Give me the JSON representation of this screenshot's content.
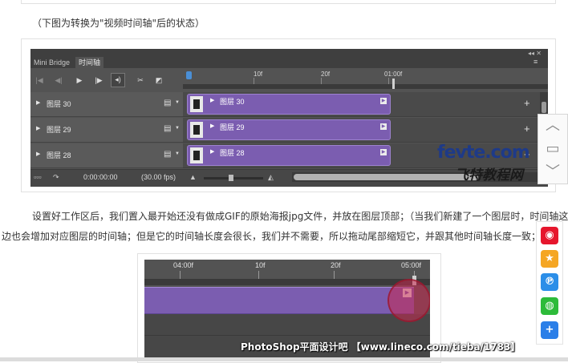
{
  "caption": "（下图为转换为\"视频时间轴\"后的状态）",
  "ps_panel": {
    "tabs": [
      {
        "label": "Mini Bridge"
      },
      {
        "label": "时间轴"
      }
    ],
    "ruler_labels": [
      "10f",
      "20f",
      "01:00f"
    ],
    "layers": [
      {
        "name": "图层 30",
        "clip": "图层 30"
      },
      {
        "name": "图层 29",
        "clip": "图层 29"
      },
      {
        "name": "图层 28",
        "clip": "图层 28"
      }
    ],
    "time": "0:00:00:00",
    "fps": "(30.00 fps)"
  },
  "watermark": {
    "domain": "fevte.com",
    "cn": "飞特教程网"
  },
  "paragraph": {
    "line1": "设置好工作区后，我们置入最开始还没有做成GIF的原始海报jpg文件，并放在图层顶部；（当我们新建了一个图层时，时间轴这",
    "line2": "边也会增加对应图层的时间轴；但是它的时间轴长度会很长，我们并不需要，所以拖动尾部缩短它，并跟其他时间轴长度一致；"
  },
  "shot2": {
    "ruler_labels": [
      "04:00f",
      "10f",
      "20f",
      "05:00f"
    ],
    "watermark": "PhotoShop平面设计吧 【www.lineco.com/tieba/1783】"
  },
  "colors": {
    "clip_purple": "#7b5db0",
    "panel_gray": "#535353",
    "watermark_blue": "#1e3a88",
    "highlight_red": "#c82850"
  }
}
